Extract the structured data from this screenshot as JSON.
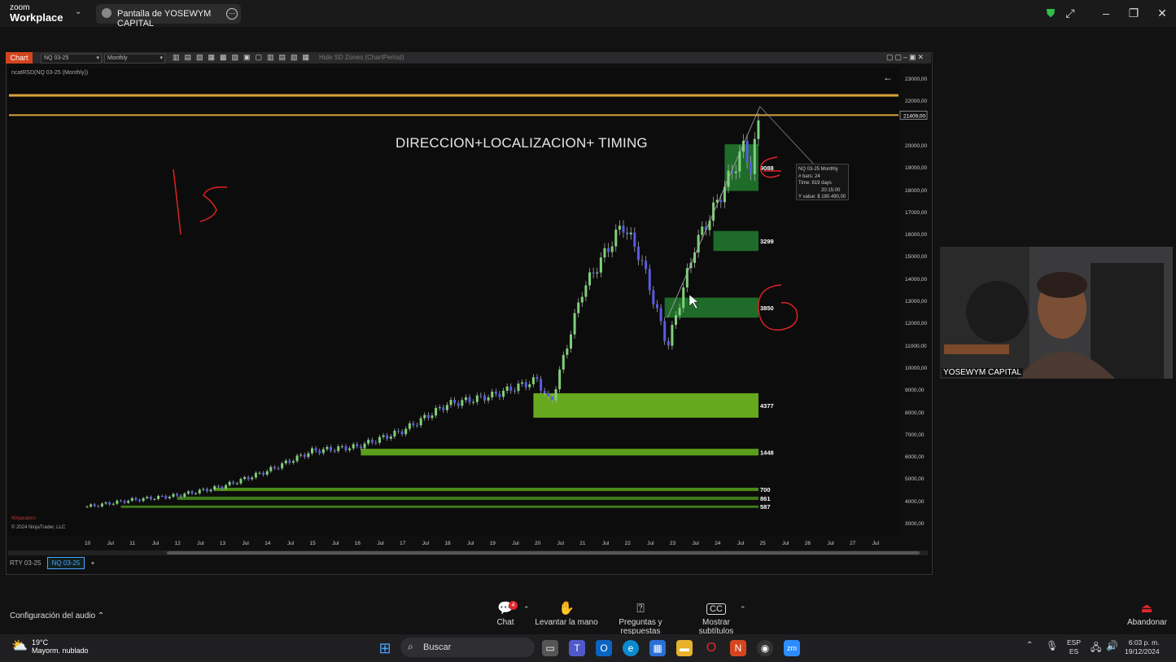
{
  "zoom": {
    "brand_line1": "zoom",
    "brand_line2": "Workplace",
    "share_label": "Pantalla de YOSEWYM CAPITAL"
  },
  "chart_window": {
    "tab_label": "Chart",
    "instrument_select": "NQ 03-25",
    "period_select": "Monthly",
    "toolbar_text": "Hide SD Zones (ChartPeriod)",
    "series_label": "ncatRSD(NQ 03-25 (Monthly))",
    "overlay_title": "DIRECCION+LOCALIZACION+ TIMING",
    "copyright": "© 2024 NinjaTrader, LLC",
    "logo_text": "Ninjacators",
    "tooltip": [
      "NQ 03-25 Monthly",
      "# bars:   24",
      "Time:   819 days",
      "20:15:00",
      "Y value: $ 180.490,00"
    ],
    "bottom_tabs": [
      "RTY 03-25",
      "NQ 03-25"
    ],
    "add_tab": "+"
  },
  "chart_data": {
    "type": "candlestick",
    "instrument": "NQ 03-25",
    "period": "Monthly",
    "price_axis": [
      "23000,00",
      "22000,00",
      "21000,00",
      "20000,00",
      "19000,00",
      "18000,00",
      "17000,00",
      "16000,00",
      "15000,00",
      "14000,00",
      "13000,00",
      "12000,00",
      "11000,00",
      "10000,00",
      "9000,00",
      "8000,00",
      "7000,00",
      "6000,00",
      "5000,00",
      "4000,00",
      "3000,00"
    ],
    "price_marker": "21409,00",
    "x_axis": [
      "10",
      "Jul",
      "11",
      "Jul",
      "12",
      "Jul",
      "13",
      "Jul",
      "14",
      "Jul",
      "15",
      "Jul",
      "16",
      "Jul",
      "17",
      "Jul",
      "18",
      "Jul",
      "19",
      "Jul",
      "20",
      "Jul",
      "21",
      "Jul",
      "22",
      "Jul",
      "23",
      "Jul",
      "24",
      "Jul",
      "25",
      "Jul",
      "26",
      "Jul",
      "27",
      "Jul"
    ],
    "ylim": [
      2700,
      23700
    ],
    "horizontal_lines": [
      22300,
      21409
    ],
    "zones": [
      {
        "label": "9088",
        "low": 18000,
        "high": 20100,
        "start": "2024-03"
      },
      {
        "label": "3299",
        "low": 15300,
        "high": 16200,
        "start": "2023-12"
      },
      {
        "label": "3850",
        "low": 12300,
        "high": 13200,
        "start": "2022-11"
      },
      {
        "label": "4377",
        "low": 7800,
        "high": 8900,
        "start": "2019-12"
      },
      {
        "label": "1448",
        "low": 6100,
        "high": 6400,
        "start": "2016-02"
      },
      {
        "label": "700",
        "low": 4500,
        "high": 4650,
        "start": "2012-11"
      },
      {
        "label": "861",
        "low": 4100,
        "high": 4250,
        "start": "2012-01"
      },
      {
        "label": "587",
        "low": 3750,
        "high": 3850,
        "start": "2010-10"
      }
    ],
    "trend": [
      {
        "t": 2010.0,
        "v": 3800
      },
      {
        "t": 2011.0,
        "v": 4100
      },
      {
        "t": 2012.0,
        "v": 4300
      },
      {
        "t": 2013.0,
        "v": 4700
      },
      {
        "t": 2014.0,
        "v": 5400
      },
      {
        "t": 2015.0,
        "v": 6300
      },
      {
        "t": 2016.0,
        "v": 6500
      },
      {
        "t": 2017.0,
        "v": 7200
      },
      {
        "t": 2018.0,
        "v": 8400
      },
      {
        "t": 2019.0,
        "v": 8800
      },
      {
        "t": 2020.0,
        "v": 9500
      },
      {
        "t": 2020.3,
        "v": 8400
      },
      {
        "t": 2021.0,
        "v": 13500
      },
      {
        "t": 2021.9,
        "v": 16500
      },
      {
        "t": 2022.3,
        "v": 15000
      },
      {
        "t": 2022.9,
        "v": 11000
      },
      {
        "t": 2023.5,
        "v": 15500
      },
      {
        "t": 2024.0,
        "v": 17500
      },
      {
        "t": 2024.6,
        "v": 20000
      },
      {
        "t": 2024.75,
        "v": 19000
      },
      {
        "t": 2024.95,
        "v": 21400
      }
    ]
  },
  "annotations": {
    "handwritten": "15"
  },
  "video": {
    "name": "YOSEWYM CAPITAL"
  },
  "controls": {
    "audio": "Configuración del audio",
    "chat": "Chat",
    "chat_badge": "4",
    "raise_hand": "Levantar la mano",
    "qa": "Preguntas y respuestas",
    "captions": "Mostrar subtítulos",
    "leave": "Abandonar"
  },
  "taskbar": {
    "weather_temp": "19°C",
    "weather_desc": "Mayorm. nublado",
    "search": "Buscar",
    "lang1": "ESP",
    "lang2": "ES",
    "time": "6:03 p. m.",
    "date": "19/12/2024"
  }
}
